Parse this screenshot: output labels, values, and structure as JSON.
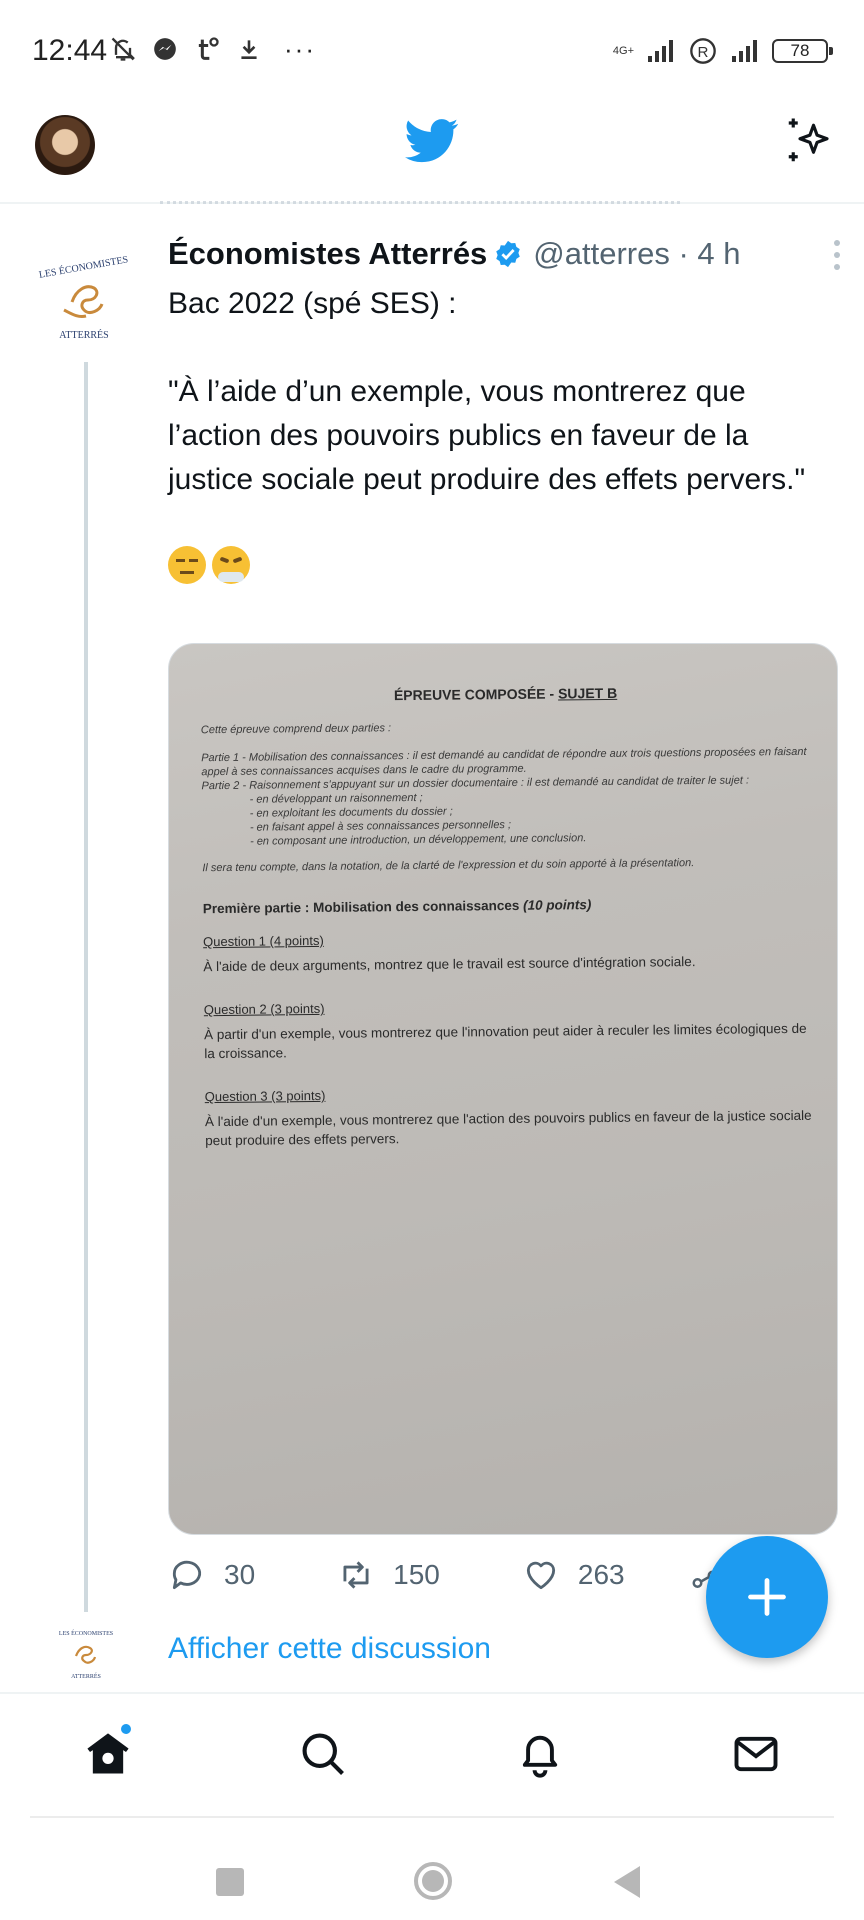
{
  "status_bar": {
    "time": "12:44",
    "network": "4G+",
    "battery": "78",
    "more": "···",
    "notification_icons": [
      "bell-off-icon",
      "messenger-icon",
      "tumblr-icon",
      "download-icon"
    ]
  },
  "header": {
    "logo": "twitter-bird",
    "action_icon": "sparkle-icon"
  },
  "tweet": {
    "author_name": "Économistes Atterrés",
    "handle": "@atterres · 4 h",
    "text_line1": "Bac 2022 (spé SES) :",
    "text_quote": "\"À l’aide d’un exemple, vous montrerez que l’action des pouvoirs publics en faveur de la justice sociale peut produire des effets pervers.\"",
    "emojis": [
      "expressionless-face",
      "face-with-steam"
    ],
    "image": {
      "title_prefix": "ÉPREUVE COMPOSÉE - ",
      "title_underlined": "SUJET B",
      "intro": "Cette épreuve comprend deux parties :",
      "part1": "Partie 1 - Mobilisation des connaissances : il est demandé au candidat de répondre aux trois questions proposées en faisant appel à ses connaissances acquises dans le cadre du programme.",
      "part2": "Partie 2 - Raisonnement s'appuyant sur un dossier documentaire : il est demandé au candidat de traiter le sujet :",
      "bullets": [
        "- en développant un raisonnement ;",
        "- en exploitant les documents du dossier ;",
        "- en faisant appel à ses connaissances personnelles ;",
        "- en composant une introduction, un développement, une conclusion."
      ],
      "note": "Il sera tenu compte, dans la notation, de la clarté de l'expression et du soin apporté à la présentation.",
      "section_title": "Première partie : Mobilisation des connaissances ",
      "section_points": "(10 points)",
      "questions": [
        {
          "head": "Question 1 (4 points)",
          "text": "À l'aide de deux arguments, montrez que le travail est source d'intégration sociale."
        },
        {
          "head": "Question 2 (3 points)",
          "text": "À partir d'un exemple, vous montrerez que l'innovation peut aider à reculer les limites écologiques de la croissance."
        },
        {
          "head": "Question 3 (3 points)",
          "text": "À l'aide d'un exemple, vous montrerez que l'action des pouvoirs publics en faveur de la justice sociale peut produire des effets pervers."
        }
      ]
    },
    "replies": "30",
    "retweets": "150",
    "likes": "263"
  },
  "show_thread": "Afficher cette discussion",
  "colors": {
    "accent": "#1d9bf0",
    "text": "#0f1419",
    "secondary": "#536471"
  }
}
